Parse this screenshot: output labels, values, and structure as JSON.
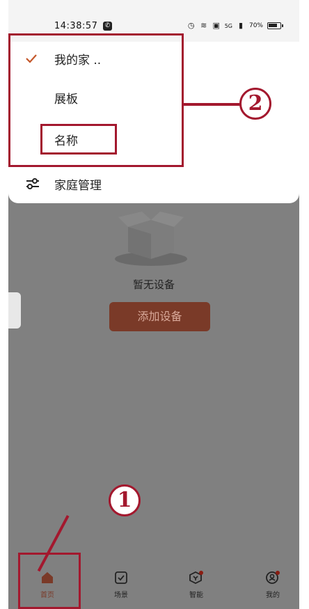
{
  "status_bar": {
    "time": "14:38:57",
    "battery": "70%",
    "signal": "5G"
  },
  "dropdown": {
    "items": [
      {
        "label": "我的家 ..",
        "selected": true
      },
      {
        "label": "展板",
        "selected": false
      },
      {
        "label": "名称",
        "selected": false
      },
      {
        "label": "家庭管理",
        "icon": "sliders-icon"
      }
    ]
  },
  "empty_state": {
    "message": "暂无设备",
    "add_button": "添加设备"
  },
  "bottom_nav": {
    "items": [
      {
        "label": "首页",
        "icon": "home-icon",
        "active": true
      },
      {
        "label": "场景",
        "icon": "checkbox-icon",
        "active": false
      },
      {
        "label": "智能",
        "icon": "smart-icon",
        "active": false,
        "badge": true
      },
      {
        "label": "我的",
        "icon": "profile-icon",
        "active": false,
        "badge": true
      }
    ]
  },
  "annotations": {
    "badge_1": "1",
    "badge_2": "2"
  },
  "colors": {
    "accent": "#7a3a28",
    "annotation": "#a3182e",
    "check": "#c4572a"
  }
}
